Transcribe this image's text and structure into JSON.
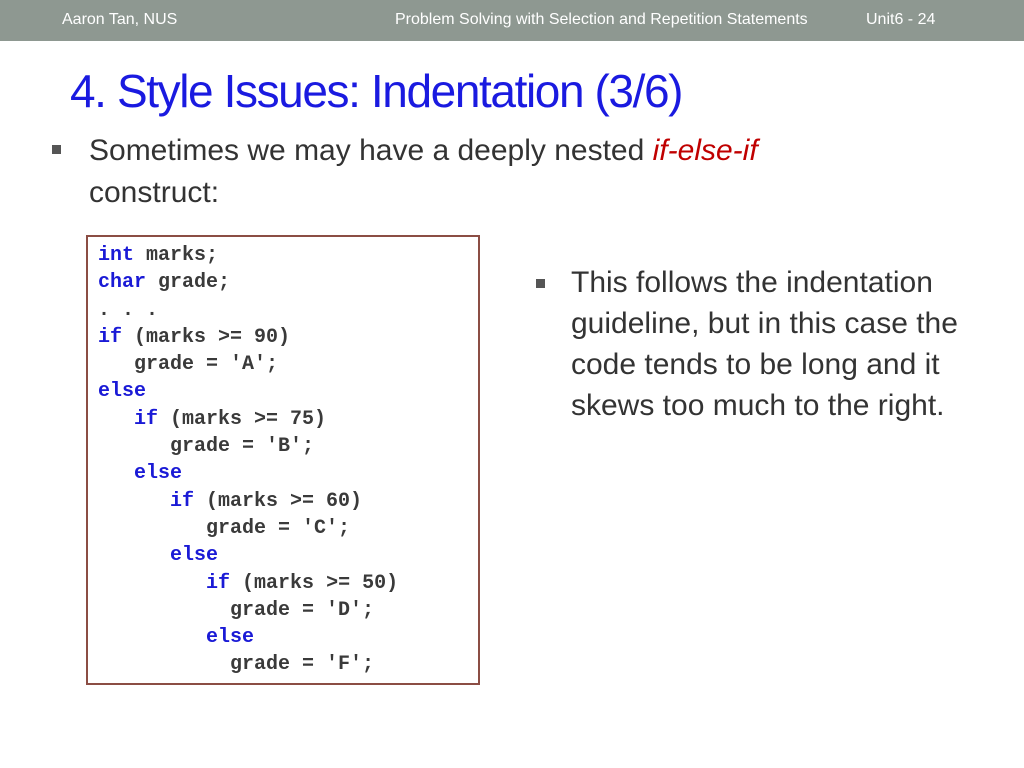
{
  "header": {
    "author": "Aaron Tan, NUS",
    "course": "Problem Solving with Selection and Repetition Statements",
    "slide_number": "Unit6 - 24"
  },
  "slide": {
    "title": "4. Style Issues: Indentation (3/6)",
    "bullet1": {
      "text_before": "Sometimes we may have a deeply nested ",
      "emphasis": "if-else-if",
      "text_after": " construct:"
    },
    "code_lines": [
      {
        "indent": "",
        "kw": "int",
        "rest": " marks;"
      },
      {
        "indent": "",
        "kw": "char",
        "rest": " grade;"
      },
      {
        "indent": "",
        "kw": "",
        "rest": ". . ."
      },
      {
        "indent": "",
        "kw": "if",
        "rest": " (marks >= 90)"
      },
      {
        "indent": "   ",
        "kw": "",
        "rest": "grade = 'A';"
      },
      {
        "indent": "",
        "kw": "else",
        "rest": ""
      },
      {
        "indent": "   ",
        "kw": "if",
        "rest": " (marks >= 75)"
      },
      {
        "indent": "      ",
        "kw": "",
        "rest": "grade = 'B';"
      },
      {
        "indent": "   ",
        "kw": "else",
        "rest": ""
      },
      {
        "indent": "      ",
        "kw": "if",
        "rest": " (marks >= 60)"
      },
      {
        "indent": "         ",
        "kw": "",
        "rest": "grade = 'C';"
      },
      {
        "indent": "      ",
        "kw": "else",
        "rest": ""
      },
      {
        "indent": "         ",
        "kw": "if",
        "rest": " (marks >= 50)"
      },
      {
        "indent": "           ",
        "kw": "",
        "rest": "grade = 'D';"
      },
      {
        "indent": "         ",
        "kw": "else",
        "rest": ""
      },
      {
        "indent": "           ",
        "kw": "",
        "rest": "grade = 'F';"
      }
    ],
    "bullet2": "This follows the indentation guideline, but in this case the code tends to be long and it skews too much to the right."
  },
  "colors": {
    "header_bg": "#8e9891",
    "title": "#1a1ae0",
    "emphasis": "#c00000",
    "keyword": "#1a1ad6",
    "code_border": "#8b4d44"
  }
}
